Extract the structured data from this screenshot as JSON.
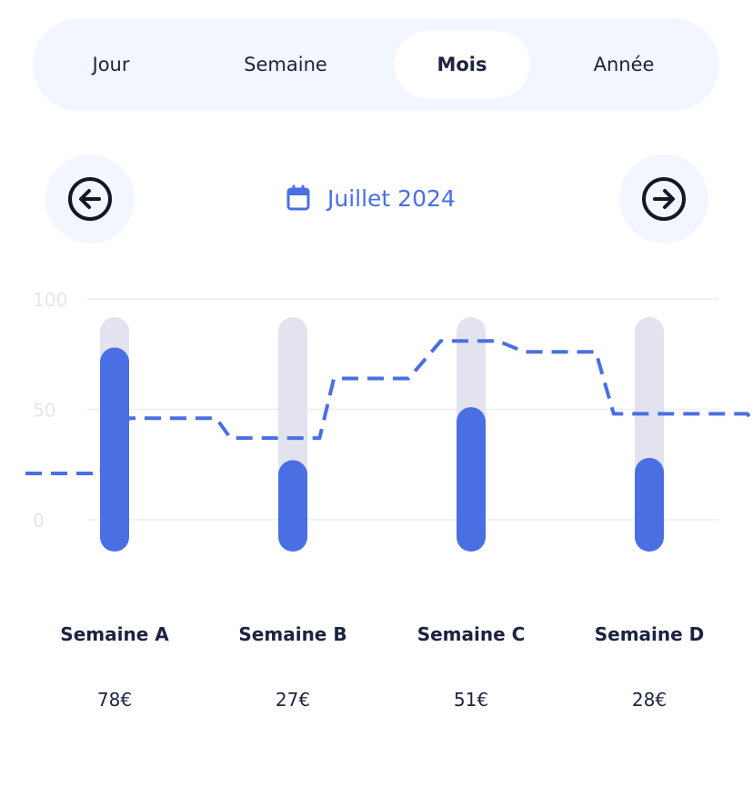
{
  "tabs": [
    {
      "label": "Jour"
    },
    {
      "label": "Semaine"
    },
    {
      "label": "Mois"
    },
    {
      "label": "Année"
    }
  ],
  "active_tab": "Mois",
  "period": {
    "label": "Juillet 2024",
    "icon": "calendar-icon",
    "prev_icon": "arrow-left-circle-icon",
    "next_icon": "arrow-right-circle-icon"
  },
  "colors": {
    "accent": "#4a6fe2",
    "track": "#e2e3ee",
    "text": "#1c2240",
    "grid": "#eceef3",
    "tick": "#e4e6ec",
    "pill_bg": "#f2f6fe"
  },
  "chart_data": {
    "type": "bar",
    "categories": [
      "Semaine A",
      "Semaine B",
      "Semaine C",
      "Semaine D"
    ],
    "values": [
      78,
      27,
      51,
      28
    ],
    "value_labels": [
      "78€",
      "27€",
      "51€",
      "28€"
    ],
    "ylim": [
      0,
      100
    ],
    "yticks": [
      0,
      50,
      100
    ],
    "grid": true,
    "line": {
      "style": "dashed",
      "x": [
        -0.5,
        -0.08,
        0.08,
        0.57,
        0.65,
        1.15,
        1.23,
        1.65,
        1.83,
        2.15,
        2.3,
        2.7,
        2.8,
        3.1,
        3.25,
        3.55,
        3.7
      ],
      "y": [
        21,
        21,
        46,
        46,
        37,
        37,
        64,
        64,
        81,
        81,
        76,
        76,
        48,
        48,
        48,
        48,
        30
      ]
    }
  }
}
